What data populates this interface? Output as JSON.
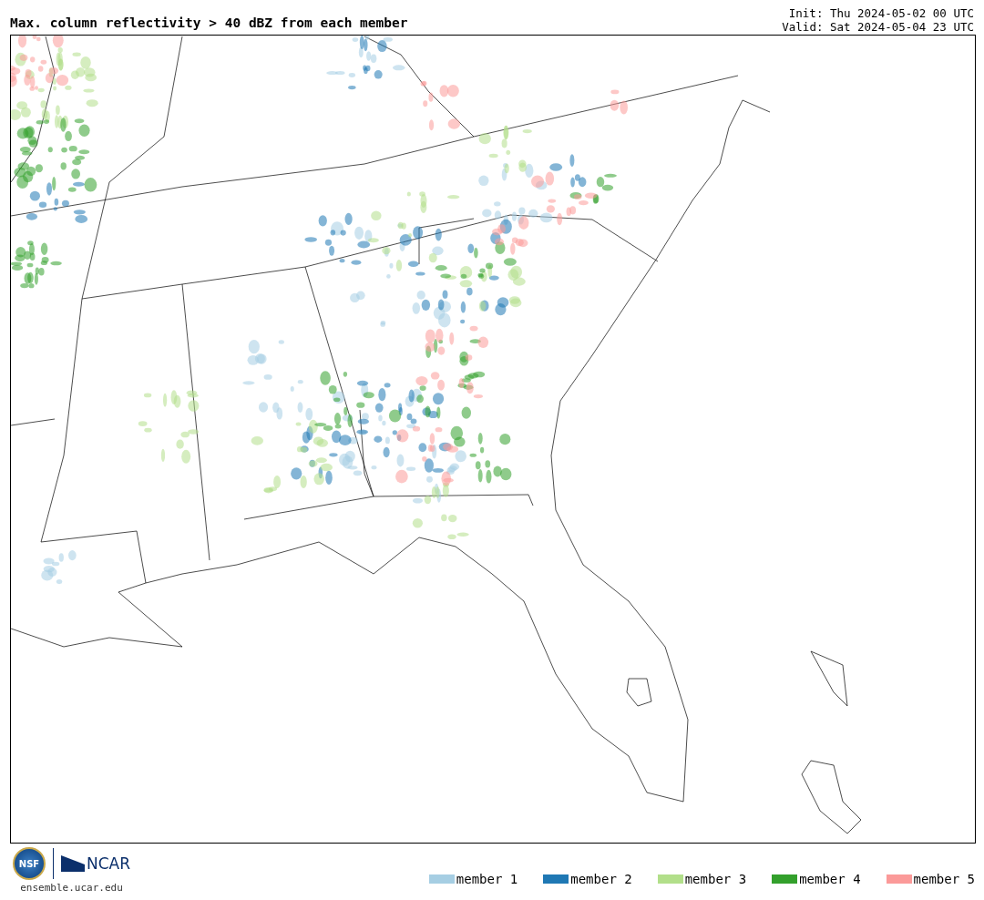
{
  "title": "Max. column reflectivity > 40 dBZ from each member",
  "init": "Init: Thu 2024-05-02 00 UTC",
  "valid": "Valid: Sat 2024-05-04 23 UTC",
  "logos": {
    "nsf": "NSF",
    "ncar": "NCAR",
    "url": "ensemble.ucar.edu"
  },
  "legend": [
    {
      "label": "member 1",
      "color": "#a6cee3"
    },
    {
      "label": "member 2",
      "color": "#1f78b4"
    },
    {
      "label": "member 3",
      "color": "#b2df8a"
    },
    {
      "label": "member 4",
      "color": "#33a02c"
    },
    {
      "label": "member 5",
      "color": "#fb9a99"
    }
  ]
}
